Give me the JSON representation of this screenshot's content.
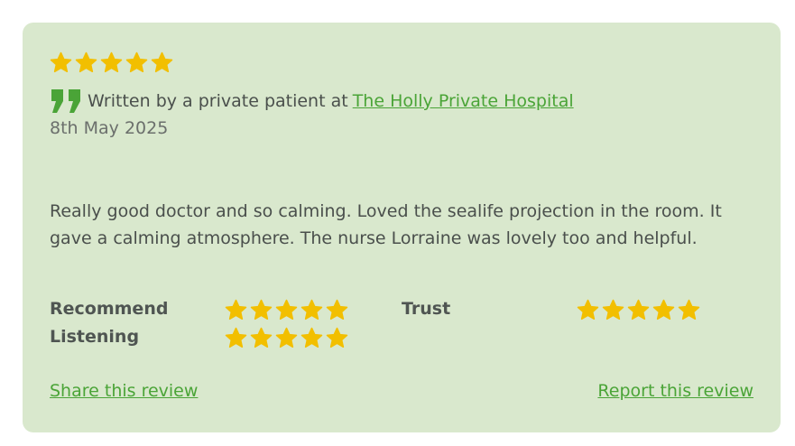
{
  "review": {
    "overall_rating": 5,
    "written_prefix": "Written by a private patient at",
    "hospital_name": "The Holly Private Hospital",
    "date": "8th May 2025",
    "text": "Really good doctor and so calming. Loved the sealife projection in the room. It gave a calming atmosphere. The nurse Lorraine was lovely too and helpful."
  },
  "ratings": [
    {
      "label": "Recommend",
      "stars": 5
    },
    {
      "label": "Trust",
      "stars": 5
    },
    {
      "label": "Listening",
      "stars": 5
    }
  ],
  "actions": {
    "share_label": "Share this review",
    "report_label": "Report this review"
  },
  "colors": {
    "card_background": "#d9e8cd",
    "star": "#f2bf00",
    "link": "#4aa437",
    "quote_icon": "#4aa437"
  },
  "icons": {
    "star": "star-icon",
    "quote": "quote-icon"
  }
}
